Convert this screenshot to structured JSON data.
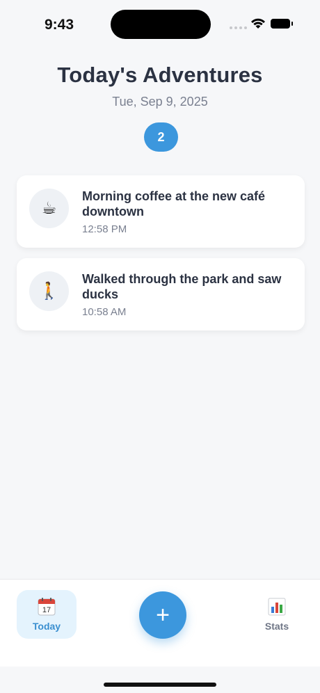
{
  "status_bar": {
    "time": "9:43",
    "icons": [
      "signal-dots-icon",
      "wifi-icon",
      "battery-icon"
    ]
  },
  "header": {
    "title": "Today's Adventures",
    "date": "Tue, Sep 9, 2025",
    "count": "2"
  },
  "entries": [
    {
      "icon": "coffee-icon",
      "emoji": "☕",
      "title": "Morning coffee at the new café downtown",
      "time": "12:58 PM"
    },
    {
      "icon": "walking-person-icon",
      "emoji": "🚶",
      "title": "Walked through the park and saw ducks",
      "time": "10:58 AM"
    }
  ],
  "tabbar": {
    "today_label": "Today",
    "stats_label": "Stats",
    "calendar_day": "17",
    "add_label": "+"
  },
  "colors": {
    "accent": "#3c97dd",
    "background": "#f6f7f9",
    "title": "#2b3242",
    "muted": "#7a8090",
    "active_tab_bg": "#e4f3fd"
  }
}
